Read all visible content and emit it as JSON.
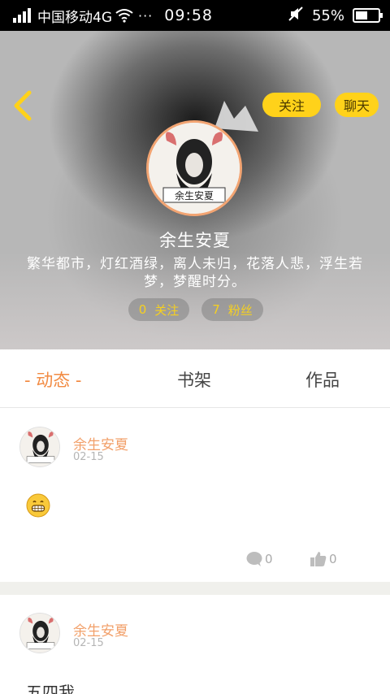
{
  "status_bar": {
    "carrier": "中国移动4G",
    "dots": "···",
    "time": "09:58",
    "battery": "55%",
    "battery_level": 0.55
  },
  "header": {
    "follow_label": "关注",
    "chat_label": "聊天",
    "username": "余生安夏",
    "bio": "繁华都市，灯红酒绿，离人未归，花落人悲，浮生若梦，梦醒时分。",
    "avatar_text": "余生安夏",
    "following_count": "0",
    "following_label": "关注",
    "fans_count": "7",
    "fans_label": "粉丝",
    "accent_color": "#ffd21a"
  },
  "tabs": {
    "active": "- 动态 -",
    "shelf": "书架",
    "works": "作品"
  },
  "posts": [
    {
      "author": "余生安夏",
      "date": "02-15",
      "content_emoji": "grinning-face-icon",
      "comments": "0",
      "likes": "0"
    },
    {
      "author": "余生安夏",
      "date": "02-15",
      "text": "五四我"
    }
  ],
  "colors": {
    "tab_active": "#f28b43",
    "author": "#f2a06a"
  }
}
